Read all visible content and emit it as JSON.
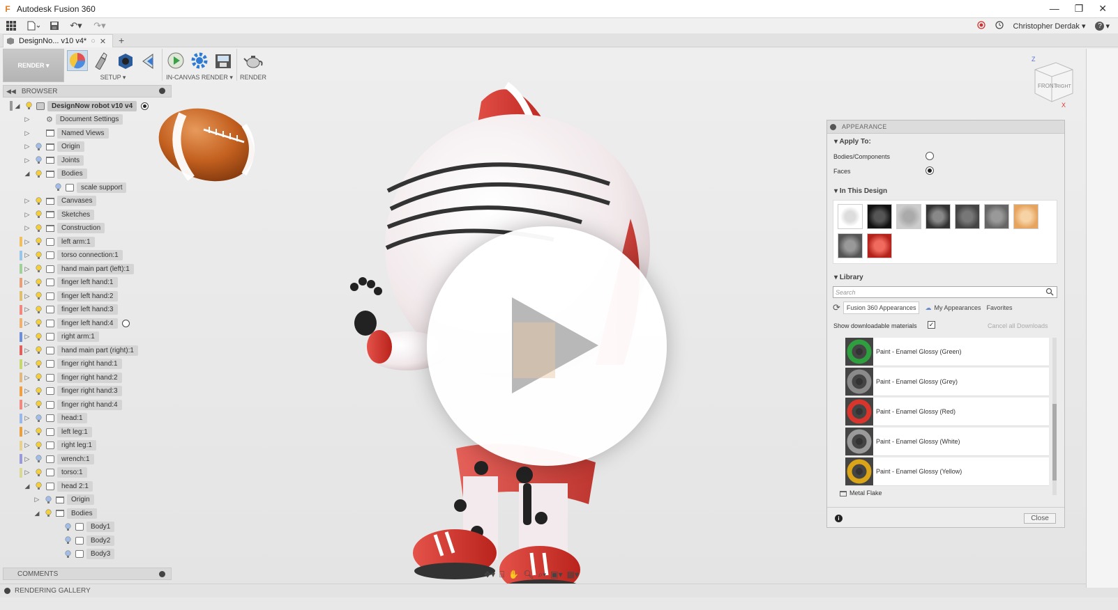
{
  "window": {
    "title": "Autodesk Fusion 360"
  },
  "qat": {
    "user": "Christopher Derdak ▾",
    "help": "?"
  },
  "doc_tab": {
    "label": "DesignNo... v10 v4*"
  },
  "ribbon": {
    "workspace": "RENDER ▾",
    "setup_label": "SETUP ▾",
    "incanvas_label": "IN-CANVAS RENDER ▾",
    "render_label": "RENDER"
  },
  "browser": {
    "header": "BROWSER",
    "items": [
      {
        "label": "DesignNow robot v10 v4",
        "bold": true
      },
      {
        "label": "Document Settings"
      },
      {
        "label": "Named Views"
      },
      {
        "label": "Origin"
      },
      {
        "label": "Joints"
      },
      {
        "label": "Bodies"
      },
      {
        "label": "scale support"
      },
      {
        "label": "Canvases"
      },
      {
        "label": "Sketches"
      },
      {
        "label": "Construction"
      },
      {
        "label": "left arm:1"
      },
      {
        "label": "torso connection:1"
      },
      {
        "label": "hand main part (left):1"
      },
      {
        "label": "finger left hand:1"
      },
      {
        "label": "finger left hand:2"
      },
      {
        "label": "finger left hand:3"
      },
      {
        "label": "finger left hand:4"
      },
      {
        "label": "right arm:1"
      },
      {
        "label": "hand main part (right):1"
      },
      {
        "label": "finger right hand:1"
      },
      {
        "label": "finger right hand:2"
      },
      {
        "label": "finger right hand:3"
      },
      {
        "label": "finger right hand:4"
      },
      {
        "label": "head:1"
      },
      {
        "label": "left leg:1"
      },
      {
        "label": "right leg:1"
      },
      {
        "label": "wrench:1"
      },
      {
        "label": "torso:1"
      },
      {
        "label": "head 2:1"
      },
      {
        "label": "Origin"
      },
      {
        "label": "Bodies"
      },
      {
        "label": "Body1"
      },
      {
        "label": "Body2"
      },
      {
        "label": "Body3"
      }
    ],
    "comments": "COMMENTS"
  },
  "status": {
    "gallery": "RENDERING GALLERY"
  },
  "appearance": {
    "header": "APPEARANCE",
    "apply_to": "Apply To:",
    "opt_bodies": "Bodies/Components",
    "opt_faces": "Faces",
    "in_design": "In This Design",
    "library": "Library",
    "search_placeholder": "Search",
    "tab_fusion": "Fusion 360 Appearances",
    "tab_my": "My Appearances",
    "tab_fav": "Favorites",
    "show_downloadable": "Show downloadable materials",
    "cancel_downloads": "Cancel all Downloads",
    "materials": [
      {
        "label": "Paint - Enamel Glossy (Green)",
        "color": "#2e9e3e"
      },
      {
        "label": "Paint - Enamel Glossy (Grey)",
        "color": "#8a8a8a"
      },
      {
        "label": "Paint - Enamel Glossy (Red)",
        "color": "#d8362c"
      },
      {
        "label": "Paint - Enamel Glossy (White)",
        "color": "#9a9a9a"
      },
      {
        "label": "Paint - Enamel Glossy (Yellow)",
        "color": "#d9a418"
      }
    ],
    "folder": "Metal Flake",
    "close": "Close"
  },
  "viewcube": {
    "front": "FRONT",
    "right": "RIGHT",
    "z": "Z",
    "x": "X"
  }
}
